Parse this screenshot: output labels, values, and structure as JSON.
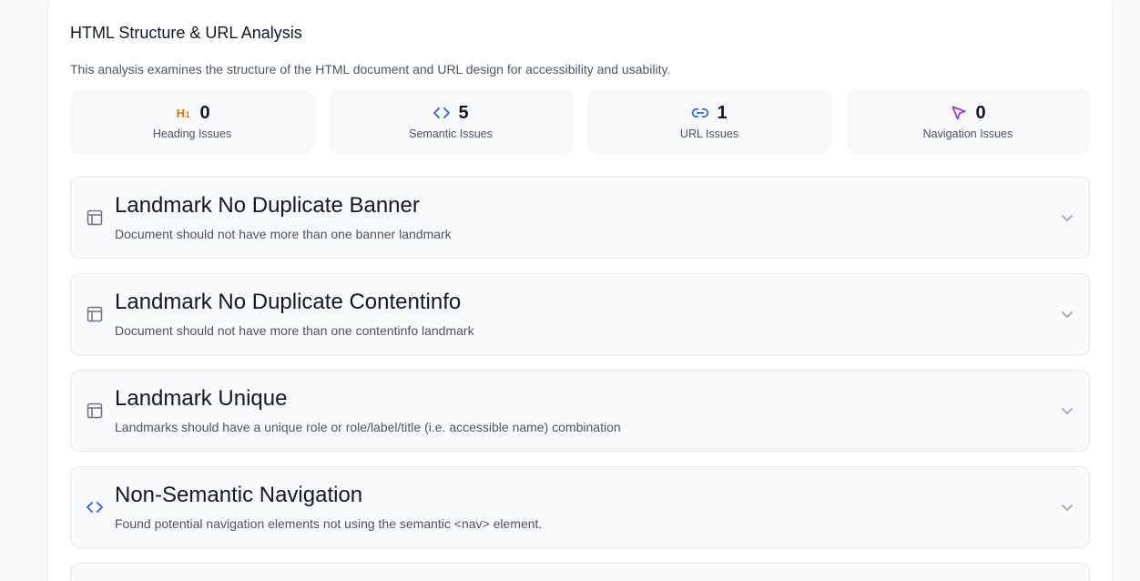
{
  "section": {
    "title": "HTML Structure & URL Analysis",
    "description": "This analysis examines the structure of the HTML document and URL design for accessibility and usability."
  },
  "stats": [
    {
      "icon": "heading-h1-icon",
      "value": "0",
      "label": "Heading Issues",
      "color": "#d97706"
    },
    {
      "icon": "code-icon",
      "value": "5",
      "label": "Semantic Issues",
      "color": "#2563eb"
    },
    {
      "icon": "link-icon",
      "value": "1",
      "label": "URL Issues",
      "color": "#2563eb"
    },
    {
      "icon": "cursor-pointer-icon",
      "value": "0",
      "label": "Navigation Issues",
      "color": "#9333ea"
    }
  ],
  "issues": [
    {
      "icon": "layout-icon",
      "title": "Landmark No Duplicate Banner",
      "description": "Document should not have more than one banner landmark"
    },
    {
      "icon": "layout-icon",
      "title": "Landmark No Duplicate Contentinfo",
      "description": "Document should not have more than one contentinfo landmark"
    },
    {
      "icon": "layout-icon",
      "title": "Landmark Unique",
      "description": "Landmarks should have a unique role or role/label/title (i.e. accessible name) combination"
    },
    {
      "icon": "code-icon",
      "title": "Non-Semantic Navigation",
      "description": "Found potential navigation elements not using the semantic <nav> element."
    }
  ]
}
